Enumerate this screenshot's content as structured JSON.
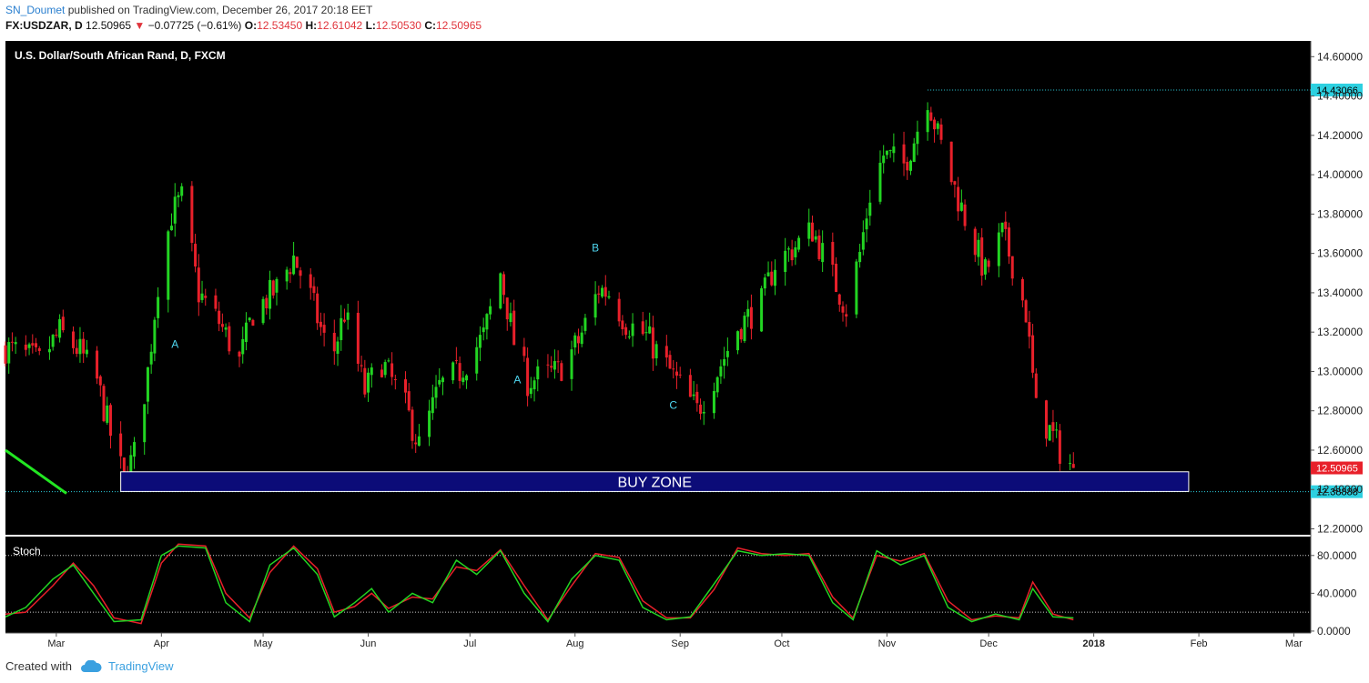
{
  "header": {
    "user": "SN_Doumet",
    "published_text": "published on TradingView.com, December 26, 2017 20:18 EET",
    "symbol": "FX:USDZAR, D",
    "last": "12.50965",
    "change_arrow": "▼",
    "change": "−0.07725 (−0.61%)",
    "o_label": "O:",
    "o": "12.53450",
    "h_label": "H:",
    "h": "12.61042",
    "l_label": "L:",
    "l": "12.50530",
    "c_label": "C:",
    "c": "12.50965"
  },
  "footer": {
    "created_with": "Created with",
    "brand": "TradingView",
    "logo_icon": "tradingview-cloud-icon"
  },
  "colors": {
    "background": "#000000",
    "up": "#22d422",
    "down": "#e8202a",
    "zone_fill": "#0c0c78",
    "zone_stroke": "#ffffff",
    "level": "#2dd0e0",
    "stoch_k": "#22d422",
    "stoch_d": "#e8202a",
    "trend": "#22e622",
    "wave": "#4fd6f0"
  },
  "chart_data": [
    {
      "type": "candlestick",
      "title": "U.S. Dollar/South African Rand, D, FXCM",
      "y_ticks": [
        "14.60000",
        "14.40000",
        "14.20000",
        "14.00000",
        "13.80000",
        "13.60000",
        "13.40000",
        "13.20000",
        "13.00000",
        "12.80000",
        "12.60000",
        "12.40000",
        "12.20000"
      ],
      "ylim": [
        12.17,
        14.68
      ],
      "x_ticks": [
        "Mar",
        "Apr",
        "May",
        "Jun",
        "Jul",
        "Aug",
        "Sep",
        "Oct",
        "Nov",
        "Dec",
        "2018",
        "Feb",
        "Mar"
      ],
      "x_range": [
        "2017-02-14",
        "2018-03-06"
      ],
      "last_date": "2017-12-26",
      "price_path": [
        [
          "2017-02-14",
          13.12
        ],
        [
          "2017-02-24",
          13.05
        ],
        [
          "2017-03-02",
          13.2
        ],
        [
          "2017-03-08",
          13.1
        ],
        [
          "2017-03-13",
          12.95
        ],
        [
          "2017-03-17",
          12.68
        ],
        [
          "2017-03-21",
          12.45
        ],
        [
          "2017-03-24",
          12.58
        ],
        [
          "2017-03-28",
          13.0
        ],
        [
          "2017-03-31",
          13.45
        ],
        [
          "2017-04-04",
          13.8
        ],
        [
          "2017-04-07",
          13.88
        ],
        [
          "2017-04-12",
          13.4
        ],
        [
          "2017-04-18",
          13.25
        ],
        [
          "2017-04-24",
          13.05
        ],
        [
          "2017-04-28",
          13.3
        ],
        [
          "2017-05-05",
          13.42
        ],
        [
          "2017-05-10",
          13.58
        ],
        [
          "2017-05-15",
          13.38
        ],
        [
          "2017-05-21",
          13.05
        ],
        [
          "2017-05-25",
          13.3
        ],
        [
          "2017-05-31",
          12.9
        ],
        [
          "2017-06-05",
          13.05
        ],
        [
          "2017-06-12",
          12.82
        ],
        [
          "2017-06-16",
          12.62
        ],
        [
          "2017-06-22",
          12.92
        ],
        [
          "2017-06-28",
          13.0
        ],
        [
          "2017-07-05",
          13.18
        ],
        [
          "2017-07-10",
          13.5
        ],
        [
          "2017-07-14",
          13.15
        ],
        [
          "2017-07-18",
          12.95
        ],
        [
          "2017-07-27",
          13.0
        ],
        [
          "2017-08-02",
          13.15
        ],
        [
          "2017-08-08",
          13.42
        ],
        [
          "2017-08-11",
          13.4
        ],
        [
          "2017-08-16",
          13.25
        ],
        [
          "2017-08-22",
          13.18
        ],
        [
          "2017-08-31",
          12.95
        ],
        [
          "2017-09-06",
          12.8
        ],
        [
          "2017-09-12",
          13.0
        ],
        [
          "2017-09-18",
          13.22
        ],
        [
          "2017-09-25",
          13.35
        ],
        [
          "2017-09-29",
          13.55
        ],
        [
          "2017-10-04",
          13.62
        ],
        [
          "2017-10-10",
          13.72
        ],
        [
          "2017-10-16",
          13.48
        ],
        [
          "2017-10-20",
          13.32
        ],
        [
          "2017-10-24",
          13.6
        ],
        [
          "2017-10-27",
          13.9
        ],
        [
          "2017-10-31",
          14.1
        ],
        [
          "2017-11-06",
          14.05
        ],
        [
          "2017-11-09",
          14.18
        ],
        [
          "2017-11-13",
          14.4
        ],
        [
          "2017-11-16",
          14.2
        ],
        [
          "2017-11-20",
          13.98
        ],
        [
          "2017-11-24",
          13.78
        ],
        [
          "2017-11-30",
          13.5
        ],
        [
          "2017-12-05",
          13.7
        ],
        [
          "2017-12-08",
          13.55
        ],
        [
          "2017-12-12",
          13.3
        ],
        [
          "2017-12-15",
          12.8
        ],
        [
          "2017-12-19",
          12.7
        ],
        [
          "2017-12-22",
          12.6
        ],
        [
          "2017-12-26",
          12.51
        ]
      ],
      "levels": [
        {
          "label": "14.43066",
          "value": 14.43066,
          "from": "2017-11-13"
        },
        {
          "label": "12.38888",
          "value": 12.38888,
          "from": "2017-02-14"
        }
      ],
      "last_price": {
        "label": "12.50965",
        "value": 12.50965
      },
      "buy_zone": {
        "label": "BUY ZONE",
        "from": "2017-03-20",
        "to": "2018-01-29",
        "y_low": 12.39,
        "y_high": 12.49
      },
      "trendline": {
        "from": [
          "2017-02-14",
          12.6
        ],
        "to": [
          "2017-03-04",
          12.38
        ]
      },
      "wave_labels": [
        {
          "text": "A",
          "date": "2017-04-05",
          "value": 13.12
        },
        {
          "text": "A",
          "date": "2017-07-15",
          "value": 12.94
        },
        {
          "text": "B",
          "date": "2017-08-07",
          "value": 13.61
        },
        {
          "text": "C",
          "date": "2017-08-30",
          "value": 12.81
        }
      ]
    },
    {
      "type": "line",
      "title": "Stoch",
      "y_ticks": [
        "80.0000",
        "40.0000",
        "0.0000"
      ],
      "ylim": [
        -2,
        100
      ],
      "bands": [
        80,
        20
      ],
      "series": [
        {
          "color": "#22d422",
          "points": [
            [
              "2017-02-14",
              15
            ],
            [
              "2017-02-20",
              25
            ],
            [
              "2017-02-28",
              55
            ],
            [
              "2017-03-06",
              70
            ],
            [
              "2017-03-12",
              40
            ],
            [
              "2017-03-18",
              10
            ],
            [
              "2017-03-26",
              12
            ],
            [
              "2017-04-01",
              80
            ],
            [
              "2017-04-06",
              90
            ],
            [
              "2017-04-14",
              88
            ],
            [
              "2017-04-20",
              30
            ],
            [
              "2017-04-27",
              10
            ],
            [
              "2017-05-03",
              70
            ],
            [
              "2017-05-10",
              88
            ],
            [
              "2017-05-17",
              60
            ],
            [
              "2017-05-22",
              15
            ],
            [
              "2017-05-28",
              30
            ],
            [
              "2017-06-02",
              45
            ],
            [
              "2017-06-07",
              20
            ],
            [
              "2017-06-14",
              40
            ],
            [
              "2017-06-20",
              30
            ],
            [
              "2017-06-27",
              75
            ],
            [
              "2017-07-03",
              60
            ],
            [
              "2017-07-10",
              85
            ],
            [
              "2017-07-17",
              40
            ],
            [
              "2017-07-24",
              10
            ],
            [
              "2017-07-31",
              55
            ],
            [
              "2017-08-07",
              80
            ],
            [
              "2017-08-14",
              75
            ],
            [
              "2017-08-21",
              25
            ],
            [
              "2017-08-28",
              12
            ],
            [
              "2017-09-04",
              15
            ],
            [
              "2017-09-11",
              50
            ],
            [
              "2017-09-18",
              85
            ],
            [
              "2017-09-25",
              80
            ],
            [
              "2017-10-02",
              82
            ],
            [
              "2017-10-09",
              80
            ],
            [
              "2017-10-16",
              30
            ],
            [
              "2017-10-22",
              12
            ],
            [
              "2017-10-29",
              85
            ],
            [
              "2017-11-05",
              70
            ],
            [
              "2017-11-12",
              80
            ],
            [
              "2017-11-19",
              25
            ],
            [
              "2017-11-26",
              10
            ],
            [
              "2017-12-03",
              18
            ],
            [
              "2017-12-10",
              12
            ],
            [
              "2017-12-14",
              45
            ],
            [
              "2017-12-20",
              15
            ],
            [
              "2017-12-26",
              14
            ]
          ]
        },
        {
          "color": "#e8202a",
          "points": [
            [
              "2017-02-14",
              18
            ],
            [
              "2017-02-20",
              20
            ],
            [
              "2017-02-28",
              48
            ],
            [
              "2017-03-06",
              72
            ],
            [
              "2017-03-12",
              48
            ],
            [
              "2017-03-18",
              14
            ],
            [
              "2017-03-26",
              8
            ],
            [
              "2017-04-01",
              72
            ],
            [
              "2017-04-06",
              92
            ],
            [
              "2017-04-14",
              90
            ],
            [
              "2017-04-20",
              40
            ],
            [
              "2017-04-27",
              14
            ],
            [
              "2017-05-03",
              62
            ],
            [
              "2017-05-10",
              90
            ],
            [
              "2017-05-17",
              66
            ],
            [
              "2017-05-22",
              20
            ],
            [
              "2017-05-28",
              26
            ],
            [
              "2017-06-02",
              40
            ],
            [
              "2017-06-07",
              24
            ],
            [
              "2017-06-14",
              36
            ],
            [
              "2017-06-20",
              34
            ],
            [
              "2017-06-27",
              68
            ],
            [
              "2017-07-03",
              64
            ],
            [
              "2017-07-10",
              86
            ],
            [
              "2017-07-17",
              48
            ],
            [
              "2017-07-24",
              12
            ],
            [
              "2017-07-31",
              48
            ],
            [
              "2017-08-07",
              82
            ],
            [
              "2017-08-14",
              78
            ],
            [
              "2017-08-21",
              32
            ],
            [
              "2017-08-28",
              14
            ],
            [
              "2017-09-04",
              14
            ],
            [
              "2017-09-11",
              44
            ],
            [
              "2017-09-18",
              88
            ],
            [
              "2017-09-25",
              82
            ],
            [
              "2017-10-02",
              80
            ],
            [
              "2017-10-09",
              82
            ],
            [
              "2017-10-16",
              36
            ],
            [
              "2017-10-22",
              14
            ],
            [
              "2017-10-29",
              80
            ],
            [
              "2017-11-05",
              74
            ],
            [
              "2017-11-12",
              82
            ],
            [
              "2017-11-19",
              32
            ],
            [
              "2017-11-26",
              12
            ],
            [
              "2017-12-03",
              16
            ],
            [
              "2017-12-10",
              14
            ],
            [
              "2017-12-14",
              52
            ],
            [
              "2017-12-20",
              18
            ],
            [
              "2017-12-26",
              12
            ]
          ]
        }
      ]
    }
  ]
}
